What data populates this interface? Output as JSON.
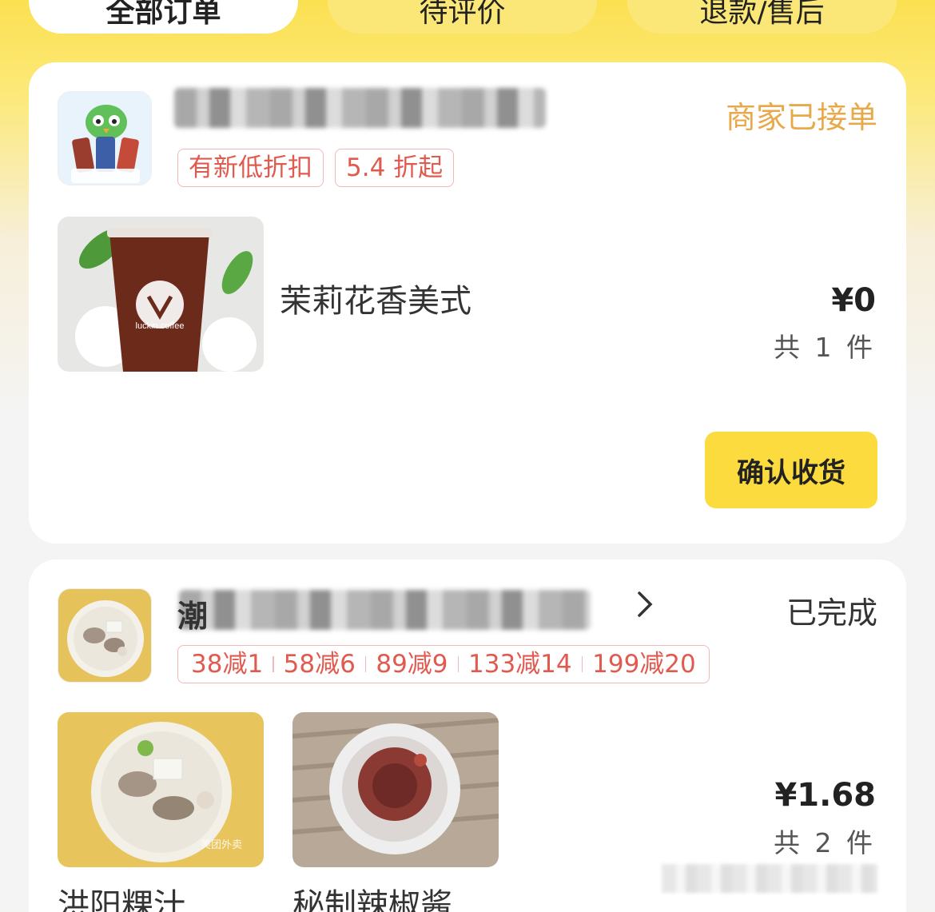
{
  "tabs": [
    {
      "label": "全部订单"
    },
    {
      "label": "待评价"
    },
    {
      "label": "退款/售后"
    }
  ],
  "orders": [
    {
      "status": "商家已接单",
      "status_color": "#e8a94a",
      "logo_text": "绿沙沙拿铁",
      "tags": [
        "有新低折扣",
        "5.4 折起"
      ],
      "items": [
        {
          "name": "茉莉花香美式",
          "image_text": "luckin coffee"
        }
      ],
      "price": "¥0",
      "count": "共 1 件",
      "action": "确认收货"
    },
    {
      "status": "已完成",
      "status_color": "#333333",
      "name_fragment": "潮",
      "tags": [
        "38减1",
        "58减6",
        "89减9",
        "133减14",
        "199减20"
      ],
      "items": [
        {
          "name": "洪阳粿汁",
          "image_text": "美团外卖"
        },
        {
          "name": "秘制辣椒酱"
        }
      ],
      "price": "¥1.68",
      "count": "共 2 件"
    }
  ]
}
